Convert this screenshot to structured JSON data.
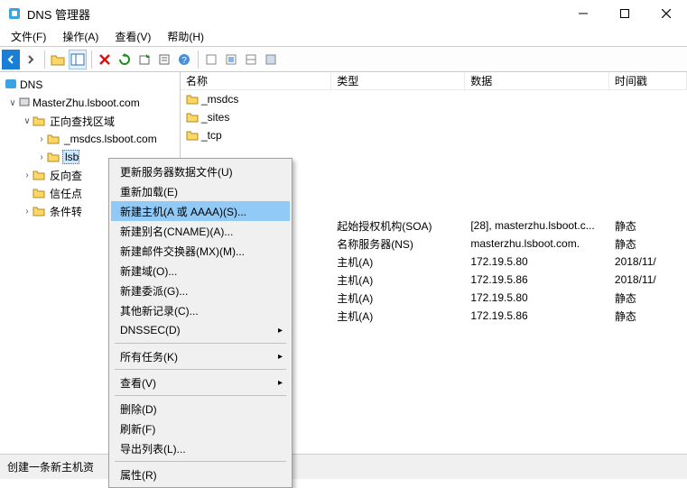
{
  "title": "DNS 管理器",
  "menus": {
    "file": "文件(F)",
    "action": "操作(A)",
    "view": "查看(V)",
    "help": "帮助(H)"
  },
  "tree": {
    "root": "DNS",
    "server": "MasterZhu.lsboot.com",
    "fwd": "正向查找区域",
    "msdcs": "_msdcs.lsboot.com",
    "lsboot_partial": "lsb",
    "rev": "反向查",
    "trust": "信任点",
    "cond": "条件转"
  },
  "columns": {
    "name": "名称",
    "type": "类型",
    "data": "数据",
    "ts": "时间戳"
  },
  "folders": [
    "_msdcs",
    "_sites",
    "_tcp"
  ],
  "records": [
    {
      "name": "",
      "type": "起始授权机构(SOA)",
      "data": "[28], masterzhu.lsboot.c...",
      "ts": "静态"
    },
    {
      "name": "",
      "type": "名称服务器(NS)",
      "data": "masterzhu.lsboot.com.",
      "ts": "静态"
    },
    {
      "name": "",
      "type": "主机(A)",
      "data": "172.19.5.80",
      "ts": "2018/11/"
    },
    {
      "name": "",
      "type": "主机(A)",
      "data": "172.19.5.86",
      "ts": "2018/11/"
    },
    {
      "name": "",
      "type": "主机(A)",
      "data": "172.19.5.80",
      "ts": "静态"
    },
    {
      "name": "",
      "type": "主机(A)",
      "data": "172.19.5.86",
      "ts": "静态"
    }
  ],
  "ctx": {
    "update": "更新服务器数据文件(U)",
    "reload": "重新加载(E)",
    "newhost": "新建主机(A 或 AAAA)(S)...",
    "newalias": "新建别名(CNAME)(A)...",
    "newmx": "新建邮件交换器(MX)(M)...",
    "newdomain": "新建域(O)...",
    "newdeleg": "新建委派(G)...",
    "otherrec": "其他新记录(C)...",
    "dnssec": "DNSSEC(D)",
    "alltasks": "所有任务(K)",
    "viewm": "查看(V)",
    "delete": "删除(D)",
    "refresh": "刷新(F)",
    "export": "导出列表(L)...",
    "props": "属性(R)"
  },
  "status": "创建一条新主机资"
}
